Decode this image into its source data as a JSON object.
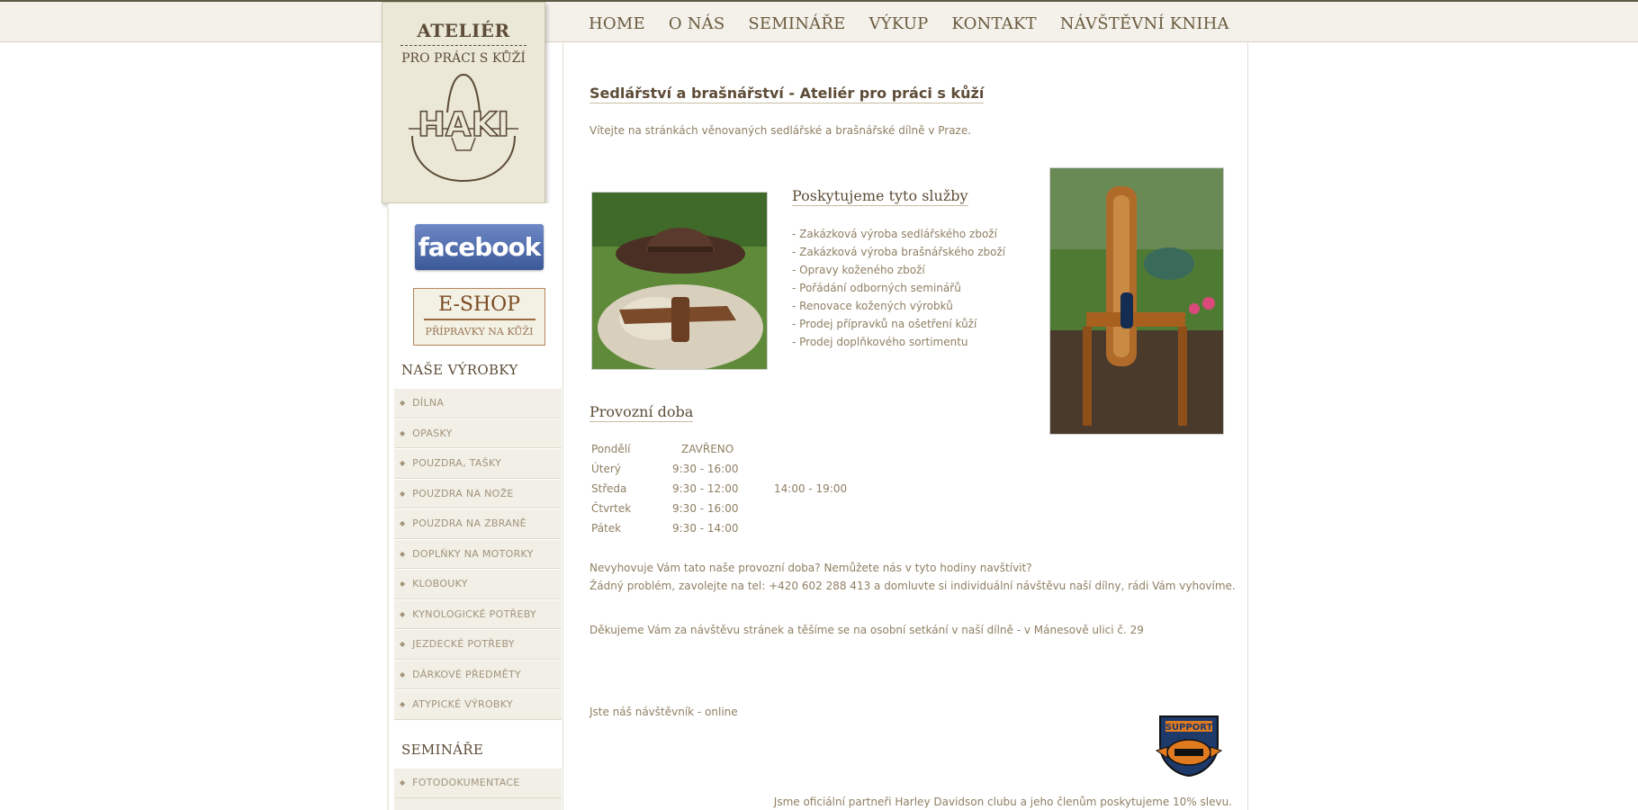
{
  "nav": {
    "items": [
      "HOME",
      "O NÁS",
      "SEMINÁŘE",
      "VÝKUP",
      "KONTAKT",
      "NÁVŠTĚVNÍ KNIHA"
    ]
  },
  "logo": {
    "title": "ATELIÉR",
    "subtitle": "PRO PRÁCI S KŮŽÍ",
    "brand": "HAKI"
  },
  "sidebar": {
    "facebook_label": "facebook",
    "eshop": {
      "title": "E-SHOP",
      "subtitle": "PŘÍPRAVKY NA KŮŽI"
    },
    "products_heading": "NAŠE VÝROBKY",
    "products": [
      "DÍLNA",
      "OPASKY",
      "POUZDRA, TAŠKY",
      "POUZDRA NA NOŽE",
      "POUZDRA NA ZBRANĚ",
      "DOPLŇKY NA MOTORKY",
      "KLOBOUKY",
      "KYNOLOGICKÉ POTŘEBY",
      "JEZDECKÉ POTŘEBY",
      "DÁRKOVÉ PŘEDMĚTY",
      "ATYPICKÉ VÝROBKY"
    ],
    "seminars_heading": "SEMINÁŘE",
    "seminars": [
      "FOTODOKUMENTACE"
    ]
  },
  "main": {
    "title": "Sedlářství a brašnářství - Ateliér pro práci s kůží",
    "intro": "Vítejte na stránkách věnovaných sedlářské a brašnářské dílně v Praze.",
    "services_title": "Poskytujeme tyto služby",
    "services": [
      "- Zakázková výroba sedlářského zboží",
      "- Zakázková výroba brašnářského zboží",
      "- Opravy koženého zboží",
      "- Pořádání odborných seminářů",
      "- Renovace kožených výrobků",
      "- Prodej přípravků na ošetření kůží",
      "- Prodej doplňkového sortimentu"
    ],
    "hours_title": "Provozní doba",
    "hours": [
      {
        "day": "Pondělí",
        "time1": "ZAVŘENO",
        "time2": ""
      },
      {
        "day": "Úterý",
        "time1": "9:30 - 16:00",
        "time2": ""
      },
      {
        "day": "Středa",
        "time1": "9:30 - 12:00",
        "time2": "14:00 - 19:00"
      },
      {
        "day": "Čtvrtek",
        "time1": "9:30 - 16:00",
        "time2": ""
      },
      {
        "day": "Pátek",
        "time1": "9:30 - 14:00",
        "time2": ""
      }
    ],
    "note_line1": "Nevyhovuje Vám tato naše provozní doba? Nemůžete nás v tyto hodiny navštívit?",
    "note_line2": "Žádný problém, zavolejte na tel: +420 602 288 413 a domluvte si individuální návštěvu naší dílny, rádi Vám vyhovíme.",
    "thanks": "Děkujeme Vám za návštěvu stránek a těšíme se na osobní setkání v naší dílně - v Mánesově ulici č. 29",
    "visitor": "Jste náš návštěvník - online",
    "badge_top": "SUPPORT",
    "partner": "Jsme oficiální partneři Harley Davidson clubu a jeho členům poskytujeme 10% slevu."
  }
}
